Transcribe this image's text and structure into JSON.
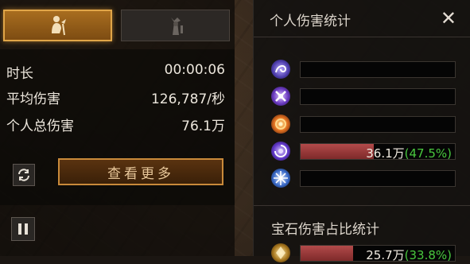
{
  "left_panel": {
    "tabs": [
      {
        "icon": "hero-figure-icon",
        "active": true
      },
      {
        "icon": "ghost-figure-icon",
        "active": false
      }
    ],
    "stats": [
      {
        "label": "时长",
        "value": "00:00:06"
      },
      {
        "label": "平均伤害",
        "value": "126,787/秒"
      },
      {
        "label": "个人总伤害",
        "value": "76.1万"
      }
    ],
    "view_more_label": "查看更多",
    "sync_icon": "sync-arrows-icon",
    "pause_icon": "pause-icon"
  },
  "right_panel": {
    "title": "个人伤害统计",
    "close_label": "✕",
    "skills": [
      {
        "icon": "purple-swirl-skill-icon",
        "value": "",
        "percent": "",
        "fill": 0,
        "color": "#6a58d8"
      },
      {
        "icon": "purple-cross-skill-icon",
        "value": "",
        "percent": "",
        "fill": 0,
        "color": "#8a5ae0"
      },
      {
        "icon": "fire-orb-skill-icon",
        "value": "",
        "percent": "",
        "fill": 0,
        "color": "#e07a2a"
      },
      {
        "icon": "violet-vortex-skill-icon",
        "value": "36.1万",
        "percent": "(47.5%)",
        "fill": 0.475,
        "color": "#7a4ad8"
      },
      {
        "icon": "blue-star-skill-icon",
        "value": "",
        "percent": "",
        "fill": 0,
        "color": "#5a8ee0"
      }
    ],
    "gem_title": "宝石伤害占比统计",
    "gem_rows": [
      {
        "icon": "gold-gem-icon",
        "value": "25.7万",
        "percent": "(33.8%)",
        "fill": 0.338,
        "color": "#c9a24a"
      }
    ]
  }
}
